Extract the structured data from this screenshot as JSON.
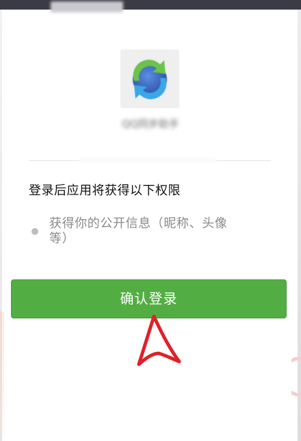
{
  "app": {
    "name": "QQ同步助手",
    "icon": "sync-arrows-icon"
  },
  "permissions": {
    "title": "登录后应用将获得以下权限",
    "items": [
      {
        "line1": "获得你的公开信息（昵称、头像",
        "line2": "等）"
      }
    ]
  },
  "actions": {
    "confirm_label": "确认登录"
  },
  "colors": {
    "confirm_button": "#52ae42",
    "annotation": "#e0202a",
    "top_bar": "#3b3b45"
  }
}
